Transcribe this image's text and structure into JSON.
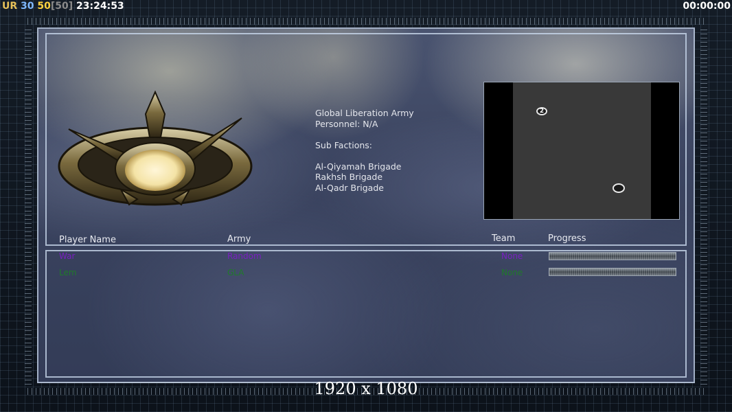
{
  "hud": {
    "ur_label": "UR",
    "fps": "30",
    "cap": "50",
    "cap_max": "[50]",
    "clock": "23:24:53",
    "timer": "00:00:00"
  },
  "faction": {
    "name": "Global Liberation Army",
    "personnel": "Personnel: N/A",
    "sub_factions_label": "Sub Factions:",
    "sub_factions": [
      "Al-Qiyamah Brigade",
      "Rakhsh Brigade",
      "Al-Qadr Brigade"
    ]
  },
  "minimap": {
    "start_positions": [
      {
        "label": "2"
      },
      {
        "label": ""
      }
    ]
  },
  "table": {
    "headers": {
      "player_name": "Player Name",
      "army": "Army",
      "team": "Team",
      "progress": "Progress"
    },
    "rows": [
      {
        "name": "War",
        "army": "Random",
        "team": "None",
        "color": "#7a1fc2",
        "progress": 1.0
      },
      {
        "name": "Lem",
        "army": "GLA",
        "team": "None",
        "color": "#1f7a2a",
        "progress": 1.0
      }
    ]
  },
  "footer": {
    "resolution": "1920 x 1080"
  },
  "colors": {
    "frame": "#0c121a",
    "panel_border": "#c8d7eb",
    "minimap_bg": "#393939"
  }
}
